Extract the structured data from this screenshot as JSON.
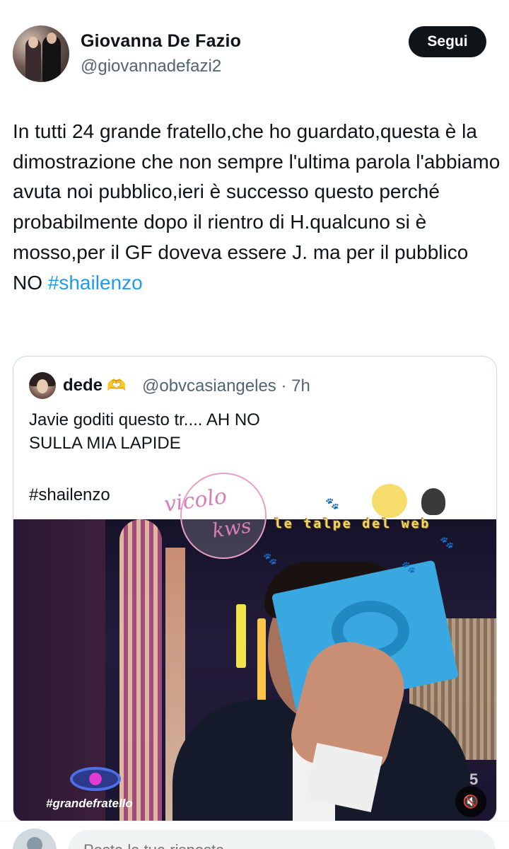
{
  "author": {
    "display_name": "Giovanna De Fazio",
    "handle": "@giovannadefazi2",
    "follow_label": "Segui"
  },
  "tweet": {
    "text": "In tutti 24 grande fratello,che ho guardato,questa è la dimostrazione che non sempre l'ultima parola l'abbiamo avuta noi pubblico,ieri è successo questo perché probabilmente dopo il rientro di H.qualcuno si è mosso,per il GF doveva essere J. ma per il pubblico NO ",
    "hashtag": "#shailenzo"
  },
  "quote": {
    "name": "dede",
    "emoji": "🫶",
    "handle_time": "@obvcasiangeles · 7h",
    "text_line1": "Javie goditi questo tr.... AH NO",
    "text_line2": "SULLA MIA LAPIDE",
    "hashtag": "#shailenzo",
    "media": {
      "show_tag": "#grandefratello",
      "corner_mark": "5",
      "mute_icon": "🔇",
      "watermark_1": "vicolo",
      "watermark_2": "kws",
      "watermark_3": "le talpe del web"
    }
  },
  "reply": {
    "placeholder": "Posta la tua risposta"
  },
  "colors": {
    "accent": "#1d9bf0",
    "text": "#0f1419",
    "muted": "#536471",
    "border": "#cfd9de"
  },
  "icons": {
    "follow": "none",
    "mute": "speaker-muted-icon",
    "avatar_placeholder": "default-avatar-icon"
  }
}
